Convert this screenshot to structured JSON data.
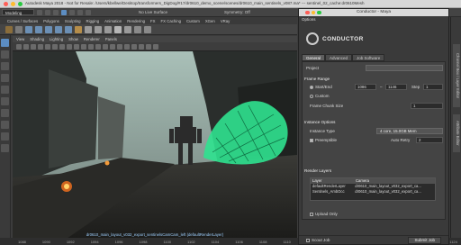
{
  "mac_title": "Autodesk Maya 2018 - Not for Resale: /Users/kbellwe/Desktop/transformers_DigDog/#17/dr0610_demo_scene/scenes/dr0610_main_sentinels_v087.ma* --- sentinel_02_cache:dr0610Mesh",
  "status_line": {
    "mode": "Modeling",
    "live_surface": "No Live Surface",
    "symmetry": "Symmetry: Off"
  },
  "shelf_tabs": [
    "Curves / Surfaces",
    "Polygons",
    "Sculpting",
    "Rigging",
    "Animation",
    "Rendering",
    "FX",
    "FX Caching",
    "Custom",
    "XGen",
    "VRay"
  ],
  "panel_menu": [
    "View",
    "Shading",
    "Lighting",
    "Show",
    "Renderer",
    "Panels"
  ],
  "camera_label": "dr0610_main_layout_v032_export_sentinelsCamCam_left (defaultRenderLayer)",
  "timeline_ticks": [
    "1088",
    "1090",
    "1092",
    "1094",
    "1096",
    "1098",
    "1100",
    "1102",
    "1104",
    "1106",
    "1108",
    "1110",
    "1112",
    "1114",
    "1116",
    "1118",
    "1120",
    "1122",
    "1124"
  ],
  "conductor": {
    "window_title": "Conductor - Maya",
    "options_label": "Options",
    "logo_text": "CONDUCTOR",
    "tabs": [
      "General",
      "Advanced",
      "Job Software"
    ],
    "project_label": "Project",
    "frame_range_label": "Frame Range",
    "start_end_label": "Start/End",
    "start_value": "1086",
    "end_value": "1146",
    "step_label": "Step",
    "step_value": "1",
    "custom_label": "Custom",
    "frame_chunk_label": "Frame Chunk Size",
    "frame_chunk_value": "1",
    "instance_options_label": "Instance Options",
    "instance_type_label": "Instance Type",
    "instance_type_value": "4 core, 15.0GB Mem",
    "preemptible_label": "Preemptible",
    "auto_retry_label": "Auto Retry",
    "auto_retry_value": "2",
    "render_layers_label": "Render Layers",
    "layer_col": "Layer",
    "camera_col": "Camera",
    "layers": [
      {
        "layer": "defaultRenderLayer",
        "camera": "dr0610_main_layout_v032_export_ca..."
      },
      {
        "layer": "Sentinels_AmbOcc",
        "camera": "dr0610_main_layout_v032_export_ca..."
      }
    ],
    "upload_only_label": "Upload Only",
    "scout_job_label": "Scout Job",
    "submit_label": "Submit Job"
  },
  "right_tabs": [
    "Channel Box / Layer Editor",
    "Attribute Editor"
  ],
  "colors": {
    "mesh_green": "#2fe28f",
    "accent_blue": "#5c8dc2"
  }
}
